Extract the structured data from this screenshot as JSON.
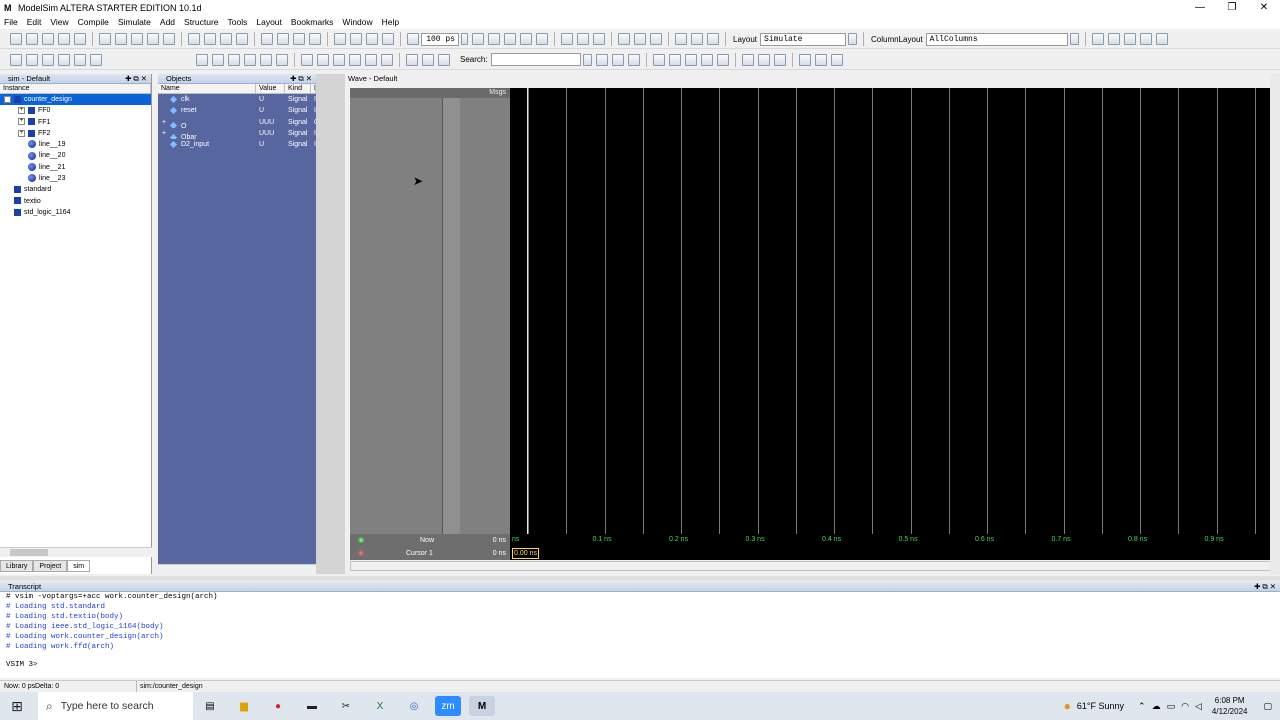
{
  "window": {
    "title": "ModelSim ALTERA STARTER EDITION 10.1d",
    "app_icon": "M",
    "min": "—",
    "max": "❐",
    "close": "✕"
  },
  "menu": [
    "File",
    "Edit",
    "View",
    "Compile",
    "Simulate",
    "Add",
    "Structure",
    "Tools",
    "Layout",
    "Bookmarks",
    "Window",
    "Help"
  ],
  "toolbar": {
    "run_length": "100 ps",
    "layout_label": "Layout",
    "layout_value": "Simulate",
    "column_layout_label": "ColumnLayout",
    "column_layout_value": "AllColumns",
    "search_label": "Search:",
    "search_value": ""
  },
  "sim_pane": {
    "title": "sim - Default",
    "column": "Instance",
    "items": [
      {
        "label": "counter_design",
        "icon": "instance-square-icon",
        "depth": 0,
        "expander": "−",
        "selected": true
      },
      {
        "label": "FF0",
        "icon": "instance-square-icon",
        "depth": 1,
        "expander": "+"
      },
      {
        "label": "FF1",
        "icon": "instance-square-icon",
        "depth": 1,
        "expander": "+"
      },
      {
        "label": "FF2",
        "icon": "instance-square-icon",
        "depth": 1,
        "expander": "+"
      },
      {
        "label": "line__19",
        "icon": "process-dot-icon",
        "depth": 1,
        "expander": ""
      },
      {
        "label": "line__20",
        "icon": "process-dot-icon",
        "depth": 1,
        "expander": ""
      },
      {
        "label": "line__21",
        "icon": "process-dot-icon",
        "depth": 1,
        "expander": ""
      },
      {
        "label": "line__23",
        "icon": "process-dot-icon",
        "depth": 1,
        "expander": ""
      },
      {
        "label": "standard",
        "icon": "package-square-icon",
        "depth": 0,
        "expander": ""
      },
      {
        "label": "textio",
        "icon": "package-square-icon",
        "depth": 0,
        "expander": ""
      },
      {
        "label": "std_logic_1164",
        "icon": "package-square-icon",
        "depth": 0,
        "expander": ""
      }
    ],
    "tabs": [
      "Library",
      "Project",
      "sim"
    ]
  },
  "objects_pane": {
    "title": "Objects",
    "columns": [
      "Name",
      "Value",
      "Kind",
      "M"
    ],
    "rows": [
      {
        "name": "clk",
        "value": "U",
        "kind": "Signal",
        "mode": "I",
        "expander": ""
      },
      {
        "name": "reset",
        "value": "U",
        "kind": "Signal",
        "mode": "I",
        "expander": ""
      },
      {
        "name": "Q",
        "value": "UUU",
        "kind": "Signal",
        "mode": "O",
        "expander": "+"
      },
      {
        "name": "Qbar",
        "value": "UUU",
        "kind": "Signal",
        "mode": "I",
        "expander": "+"
      },
      {
        "name": "D2_input",
        "value": "U",
        "kind": "Signal",
        "mode": "I",
        "expander": ""
      }
    ]
  },
  "wave_pane": {
    "title": "Wave - Default",
    "msgs_label": "Msgs",
    "now_label": "Now",
    "now_value": "0 ns",
    "cursor_label": "Cursor 1",
    "cursor_value": "0 ns",
    "cursor_marker": "0.00 ns",
    "ticks": [
      "ns",
      "0.1 ns",
      "0.2 ns",
      "0.3 ns",
      "0.4 ns",
      "0.5 ns",
      "0.6 ns",
      "0.7 ns",
      "0.8 ns",
      "0.9 ns"
    ]
  },
  "transcript": {
    "title": "Transcript",
    "command": "# vsim -voptargs=+acc work.counter_design(arch)",
    "lines": [
      "# Loading std.standard",
      "# Loading std.textio(body)",
      "# Loading ieee.std_logic_1164(body)",
      "# Loading work.counter_design(arch)",
      "# Loading work.ffd(arch)"
    ],
    "prompt": "VSIM 3>"
  },
  "status": {
    "now": "Now: 0 ps",
    "delta": "Delta: 0",
    "context": "sim:/counter_design"
  },
  "taskbar": {
    "search_placeholder": "Type here to search",
    "weather": "61°F  Sunny",
    "time": "6:08 PM",
    "date": "4/12/2024",
    "colors": {
      "taskbar_bg": "#dfe6ee",
      "accent": "#0a64d8",
      "wave_bg": "#000000",
      "grid": "#7a7a7a"
    }
  }
}
